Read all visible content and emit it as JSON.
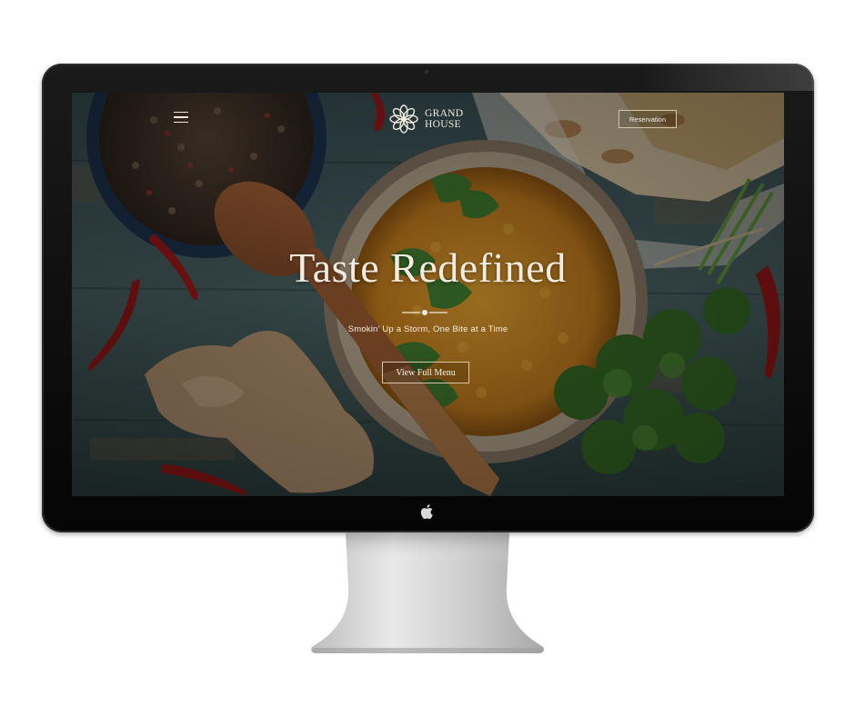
{
  "site": {
    "brand": {
      "line1": "GRAND",
      "line2": "HOUSE",
      "logo_icon": "mandala-flower-icon"
    },
    "nav": {
      "menu_icon": "hamburger-menu-icon",
      "reservation_label": "Reservation"
    },
    "hero": {
      "title": "Taste Redefined",
      "subtitle": "Smokin’ Up a Storm, One Bite at a Time",
      "cta_label": "View Full Menu",
      "divider_icon": "ornamental-divider-icon"
    }
  },
  "device": {
    "name": "desktop monitor",
    "logo_icon": "apple-logo-icon"
  },
  "colors": {
    "text_cream": "#f3ece0",
    "button_border": "#d8c7a6",
    "bezel": "#0b0b0b",
    "stand": "#c8c8c8"
  }
}
